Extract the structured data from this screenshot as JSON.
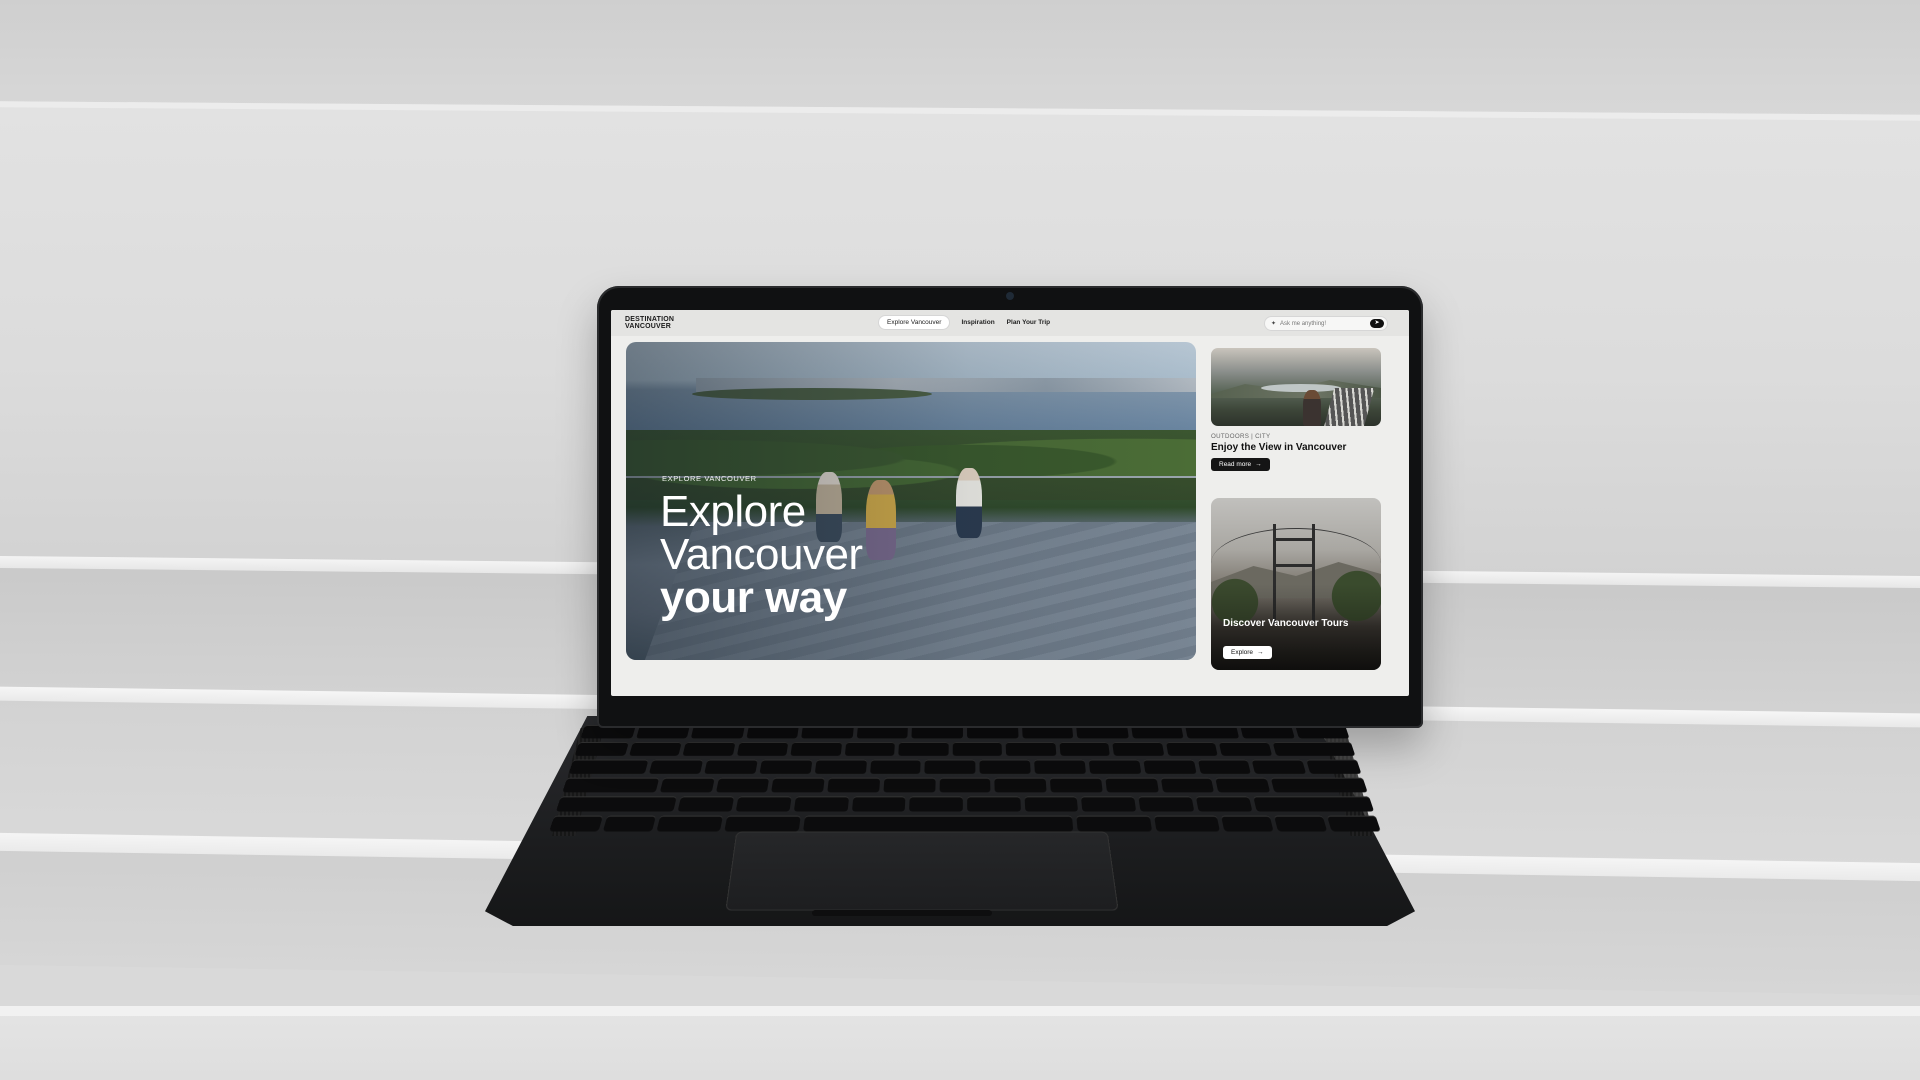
{
  "nav": {
    "logo_line1": "DESTINATION",
    "logo_line2": "VANCOUVER",
    "items": [
      {
        "label": "Explore Vancouver",
        "active": true
      },
      {
        "label": "Inspiration",
        "active": false
      },
      {
        "label": "Plan Your Trip",
        "active": false
      }
    ],
    "ask_placeholder": "Ask me anything!",
    "ask_icon": "sparkle-icon",
    "send_icon": "send-icon",
    "top_icon": "settings-icon"
  },
  "hero": {
    "kicker": "EXPLORE VANCOUVER",
    "title_line1": "Explore",
    "title_line2": "Vancouver",
    "title_line3": "your way"
  },
  "cards": [
    {
      "tags": "OUTDOORS | CITY",
      "title": "Enjoy the View in Vancouver",
      "button": "Read more",
      "button_icon": "arrow-right-icon"
    },
    {
      "title": "Discover Vancouver Tours",
      "button": "Explore",
      "button_icon": "arrow-right-icon"
    }
  ],
  "colors": {
    "nav_bg": "#e4e4e2",
    "button_dark": "#151515",
    "button_light": "#ffffff",
    "laptop_body": "#101112"
  }
}
